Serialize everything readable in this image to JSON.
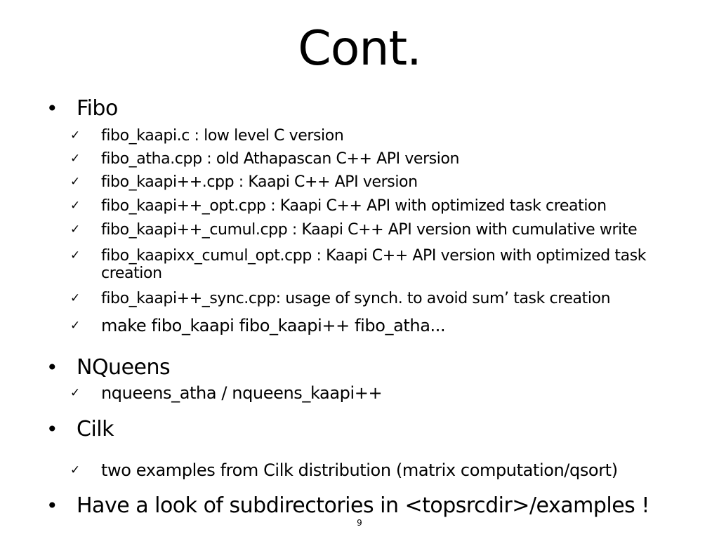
{
  "title": "Cont.",
  "bullet_glyph": "•",
  "check_glyph": "✓",
  "fibo": {
    "label": "Fibo",
    "items": [
      "fibo_kaapi.c : low level C version",
      "fibo_atha.cpp :  old Athapascan C++ API version",
      "fibo_kaapi++.cpp : Kaapi C++ API version",
      "fibo_kaapi++_opt.cpp : Kaapi C++ API with optimized task creation",
      "fibo_kaapi++_cumul.cpp : Kaapi C++ API version with cumulative write",
      "fibo_kaapixx_cumul_opt.cpp : Kaapi C++ API version with optimized task",
      "creation",
      "fibo_kaapi++_sync.cpp: usage of synch. to avoid sum’ task creation",
      "make fibo_kaapi fibo_kaapi++ fibo_atha..."
    ]
  },
  "nqueens": {
    "label": "NQueens",
    "items": [
      "nqueens_atha / nqueens_kaapi++"
    ]
  },
  "cilk": {
    "label": "Cilk",
    "items": [
      "two examples from Cilk distribution (matrix computation/qsort)"
    ]
  },
  "last_bullet": "Have a look of subdirectories in <topsrcdir>/examples !",
  "page_number": "9"
}
